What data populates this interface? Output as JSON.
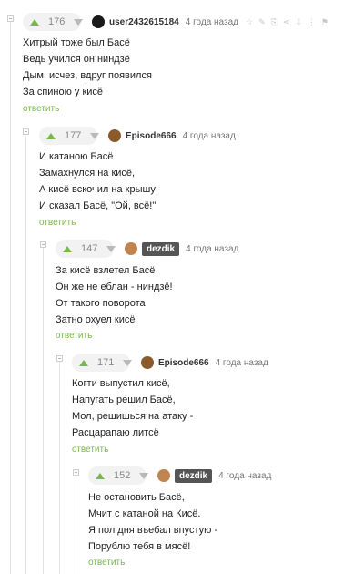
{
  "comments": [
    {
      "rating": "176",
      "author": "user2432615184",
      "time": "4 года назад",
      "lines": [
        "Хитрый тоже был Басё",
        "Ведь учился он ниндзё",
        "Дым, исчез, вдруг появился",
        "За спиною у кисё"
      ],
      "reply": "ответить",
      "avatar_color": "#1a1a1a"
    },
    {
      "rating": "177",
      "author": "Episode666",
      "time": "4 года назад",
      "lines": [
        "И катаною Басё",
        "Замахнулся на кисё,",
        "А кисё вскочил на крышу",
        "И сказал Басё, \"Ой, всё!\""
      ],
      "reply": "ответить",
      "avatar_color": "#8a5a2b"
    },
    {
      "rating": "147",
      "author": "dezdik",
      "time": "4 года назад",
      "lines": [
        "За кисё взлетел Басё",
        "Он же не еблан - ниндзё!",
        "От такого поворота",
        "Затно охуел кисё"
      ],
      "reply": "ответить",
      "avatar_color": "#c0854e"
    },
    {
      "rating": "171",
      "author": "Episode666",
      "time": "4 года назад",
      "lines": [
        "Когти выпустил кисё,",
        "Напугать решил Басё,",
        "Мол, решишься на атаку -",
        "Расцарапаю литсё"
      ],
      "reply": "ответить",
      "avatar_color": "#8a5a2b"
    },
    {
      "rating": "152",
      "author": "dezdik",
      "time": "4 года назад",
      "lines": [
        "Не остановить Басё,",
        "Мчит с катаной на Кисё.",
        "Я пол дня въебал впустую -",
        "Порублю тебя в мясё!"
      ],
      "reply": "ответить",
      "avatar_color": "#c0854e"
    }
  ],
  "colors": {
    "accent_green": "#7ab84a",
    "badge_bg": "#555555"
  },
  "icons": [
    "bookmark-icon",
    "edit-icon",
    "link-icon",
    "share-icon",
    "save-icon",
    "more-icon",
    "flag-icon"
  ]
}
